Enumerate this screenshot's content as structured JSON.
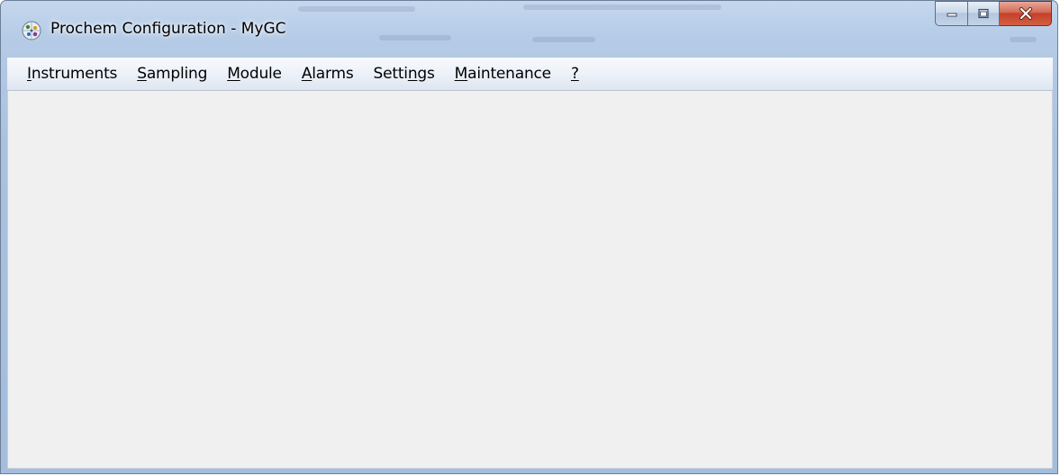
{
  "window": {
    "title": "Prochem Configuration - MyGC"
  },
  "caption_buttons": {
    "minimize_icon": "minimize-icon",
    "maximize_icon": "maximize-icon",
    "close_icon": "close-icon"
  },
  "menu": {
    "items": [
      {
        "pre": "",
        "acc": "I",
        "post": "nstruments"
      },
      {
        "pre": "",
        "acc": "S",
        "post": "ampling"
      },
      {
        "pre": "",
        "acc": "M",
        "post": "odule"
      },
      {
        "pre": "",
        "acc": "A",
        "post": "larms"
      },
      {
        "pre": "Setti",
        "acc": "n",
        "post": "gs"
      },
      {
        "pre": "",
        "acc": "M",
        "post": "aintenance"
      },
      {
        "pre": "",
        "acc": "?",
        "post": ""
      }
    ]
  },
  "colors": {
    "frame": "#a9c2e0",
    "client_background": "#f0f0f0",
    "close_button": "#c4402a"
  }
}
